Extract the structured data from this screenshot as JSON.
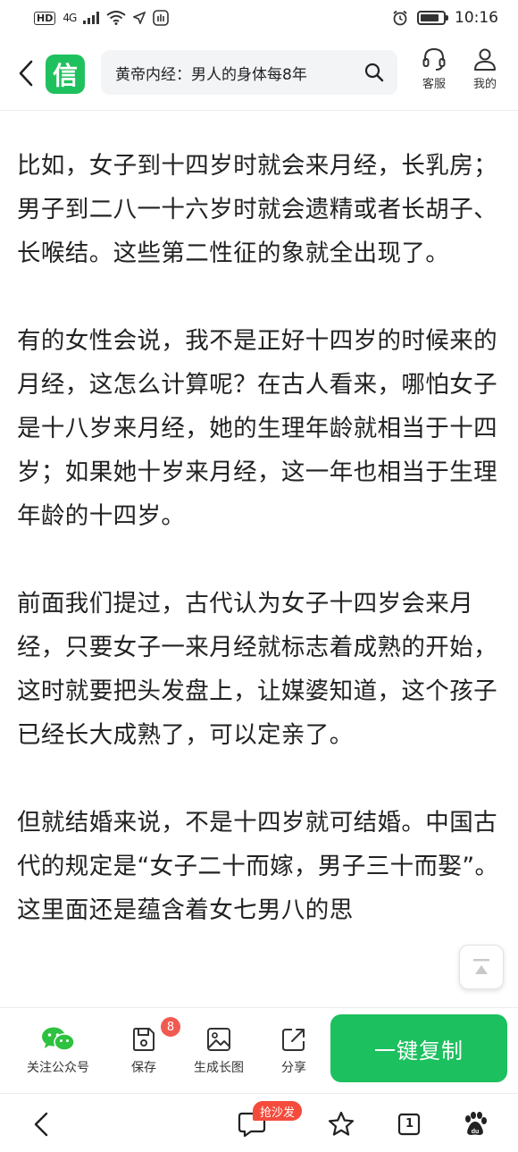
{
  "status_bar": {
    "network": "HD",
    "signal": "4G",
    "time": "10:16",
    "battery_level": 0.85
  },
  "header": {
    "logo_char": "信",
    "search_text": "黄帝内经：男人的身体每8年",
    "kefu_label": "客服",
    "me_label": "我的"
  },
  "article": {
    "paragraphs": [
      "比如，女子到十四岁时就会来月经，长乳房；男子到二八一十六岁时就会遗精或者长胡子、长喉结。这些第二性征的象就全出现了。",
      "有的女性会说，我不是正好十四岁的时候来的月经，这怎么计算呢？在古人看来，哪怕女子是十八岁来月经，她的生理年龄就相当于十四岁；如果她十岁来月经，这一年也相当于生理年龄的十四岁。",
      "前面我们提过，古代认为女子十四岁会来月经，只要女子一来月经就标志着成熟的开始，这时就要把头发盘上，让媒婆知道，这个孩子已经长大成熟了，可以定亲了。",
      "但就结婚来说，不是十四岁就可结婚。中国古代的规定是“女子二十而嫁，男子三十而娶”。这里面还是蕴含着女七男八的思"
    ]
  },
  "action_bar": {
    "wechat_label": "关注公众号",
    "save_label": "保存",
    "save_badge": "8",
    "longimg_label": "生成长图",
    "share_label": "分享",
    "copy_label": "一键复制"
  },
  "nav_bar": {
    "hot_badge": "抢沙发",
    "tabs_count": "1"
  },
  "colors": {
    "brand_green": "#1cc05f",
    "badge_red": "#f15a50"
  }
}
